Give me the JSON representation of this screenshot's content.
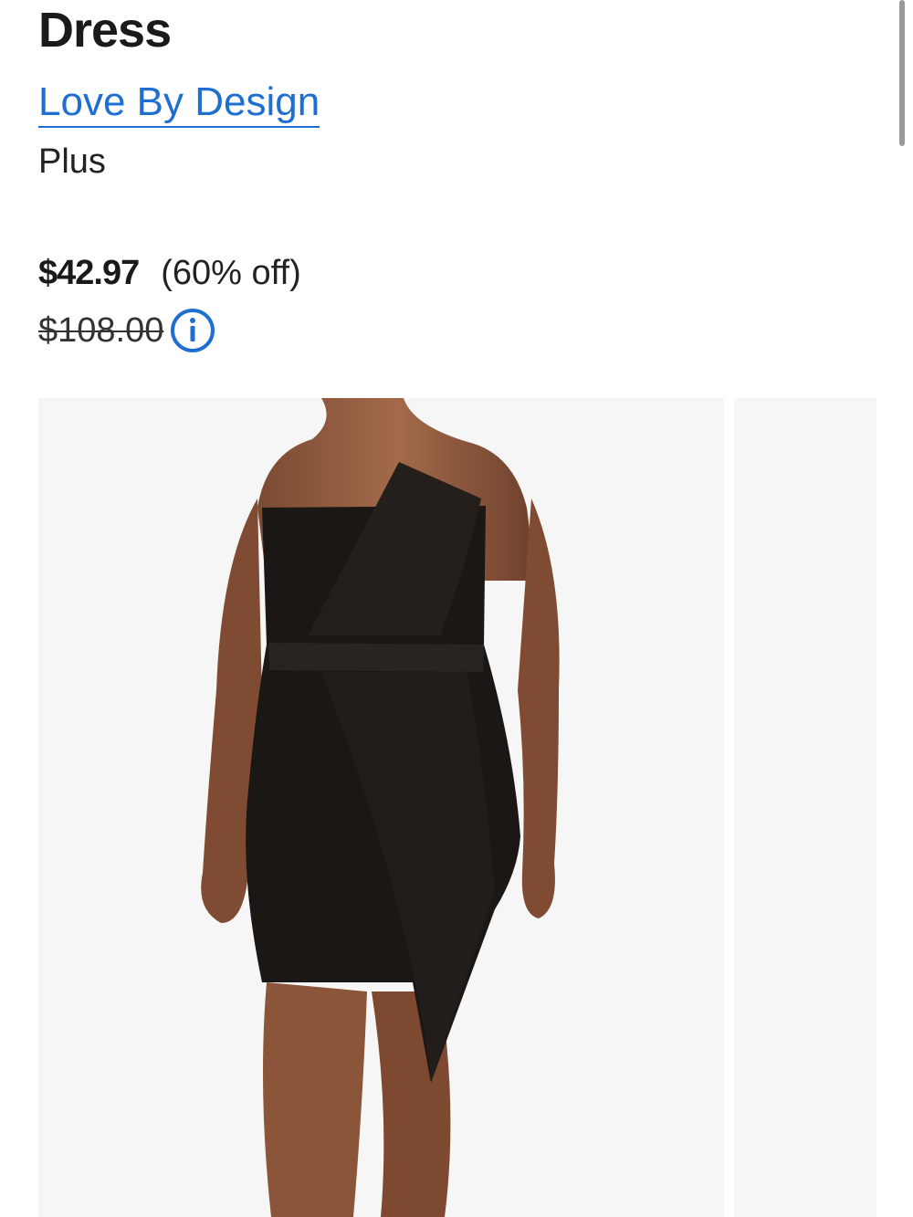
{
  "product": {
    "title": "Dress",
    "brand": "Love By Design",
    "size_category": "Plus",
    "price": "$42.97",
    "discount": "(60% off)",
    "original_price": "$108.00",
    "info_icon": "info-circle-icon"
  },
  "gallery": {
    "images": [
      "product-photo-front",
      "product-photo-next"
    ]
  },
  "colors": {
    "brand_link": "#1f6fd0",
    "image_background": "#f6f6f6"
  }
}
